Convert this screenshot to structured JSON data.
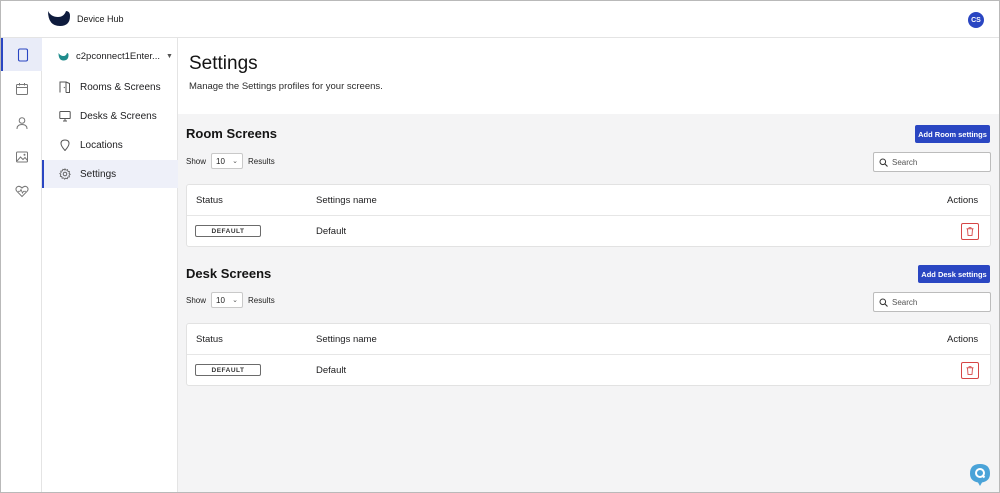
{
  "app": {
    "title": "Device Hub",
    "user_initials": "CS"
  },
  "rail": {
    "items": [
      {
        "icon": "tablet-icon",
        "active": true
      },
      {
        "icon": "calendar-icon",
        "active": false
      },
      {
        "icon": "user-icon",
        "active": false
      },
      {
        "icon": "image-icon",
        "active": false
      },
      {
        "icon": "heart-pulse-icon",
        "active": false
      }
    ]
  },
  "sidebar": {
    "org_name": "c2pconnect1Enter...",
    "items": [
      {
        "label": "Rooms & Screens",
        "icon": "door-icon",
        "active": false
      },
      {
        "label": "Desks & Screens",
        "icon": "monitor-icon",
        "active": false
      },
      {
        "label": "Locations",
        "icon": "location-pin-icon",
        "active": false
      },
      {
        "label": "Settings",
        "icon": "gear-icon",
        "active": true
      }
    ]
  },
  "page": {
    "title": "Settings",
    "subtitle": "Manage the Settings profiles for your screens."
  },
  "room_screens": {
    "title": "Room Screens",
    "add_label": "Add Room settings",
    "show_label": "Show",
    "show_value": "10",
    "results_label": "Results",
    "search_placeholder": "Search",
    "columns": [
      "Status",
      "Settings name",
      "Actions"
    ],
    "rows": [
      {
        "status": "DEFAULT",
        "name": "Default"
      }
    ]
  },
  "desk_screens": {
    "title": "Desk Screens",
    "add_label": "Add Desk settings",
    "show_label": "Show",
    "show_value": "10",
    "results_label": "Results",
    "search_placeholder": "Search",
    "columns": [
      "Status",
      "Settings name",
      "Actions"
    ],
    "rows": [
      {
        "status": "DEFAULT",
        "name": "Default"
      }
    ]
  },
  "colors": {
    "accent": "#2a46c2",
    "danger": "#d64545",
    "help": "#4aa3d8"
  }
}
